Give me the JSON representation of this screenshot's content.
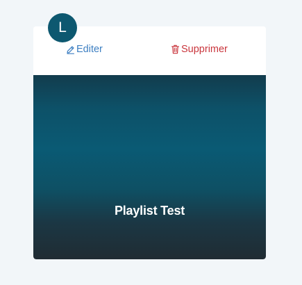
{
  "avatar": {
    "initial": "L",
    "color": "#0d5870"
  },
  "actions": {
    "edit_label": "Editer",
    "edit_icon": "pencil-icon",
    "edit_color": "#3d7fc2",
    "delete_label": "Supprimer",
    "delete_icon": "trash-icon",
    "delete_color": "#c9353c"
  },
  "playlist": {
    "title": "Playlist Test"
  }
}
